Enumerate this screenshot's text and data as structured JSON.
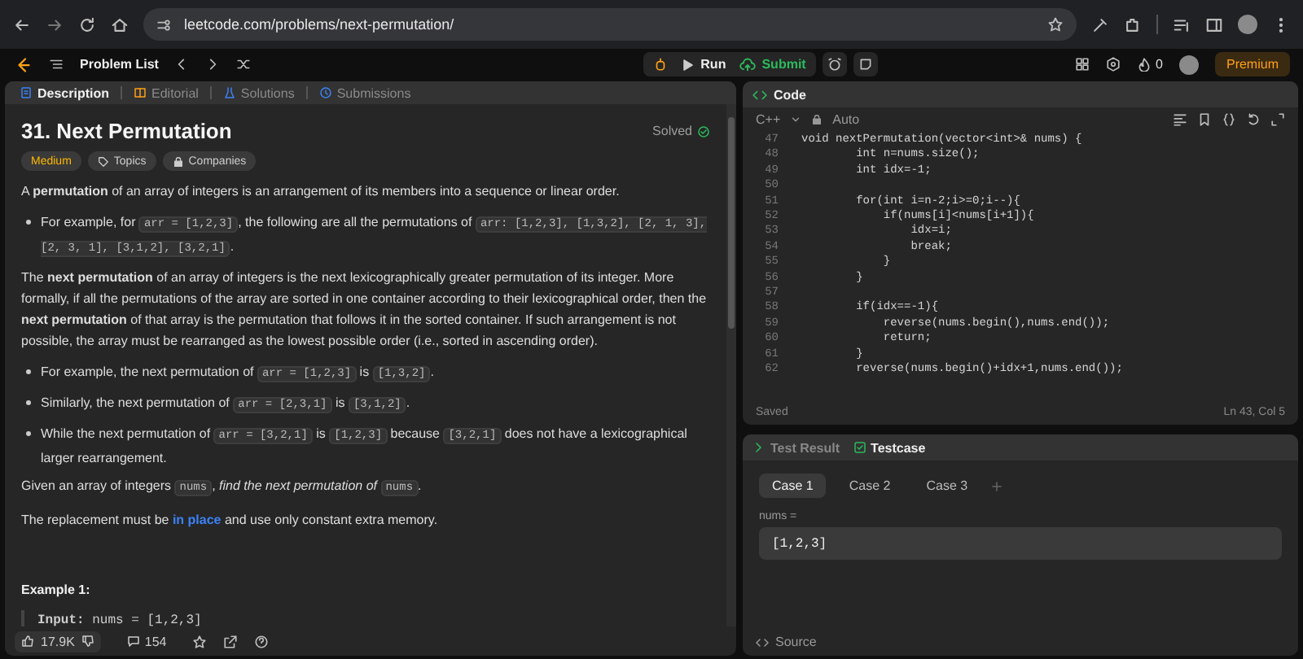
{
  "browser": {
    "url": "leetcode.com/problems/next-permutation/"
  },
  "nav": {
    "problem_list": "Problem List",
    "run": "Run",
    "submit": "Submit",
    "coins": "0",
    "premium": "Premium"
  },
  "left_tabs": [
    {
      "label": "Description",
      "selected": true
    },
    {
      "label": "Editorial",
      "selected": false
    },
    {
      "label": "Solutions",
      "selected": false
    },
    {
      "label": "Submissions",
      "selected": false
    }
  ],
  "problem": {
    "title": "31. Next Permutation",
    "status": "Solved",
    "difficulty": "Medium",
    "tags": [
      "Topics",
      "Companies"
    ]
  },
  "description": [
    {
      "kind": "p",
      "parts": [
        {
          "kind": "text",
          "text": "A **permutation** of an array of integers is an arrangement of its members into a sequence or linear order."
        }
      ]
    },
    {
      "kind": "bullet",
      "parts": [
        {
          "kind": "text",
          "text": "For example, for "
        },
        {
          "kind": "code",
          "text": "arr = [1,2,3]"
        },
        {
          "kind": "text",
          "text": ", the following are all the permutations of "
        },
        {
          "kind": "code",
          "text": "arr: [1,2,3], [1,3,2], [2, 1, 3], [2, 3, 1], [3,1,2], [3,2,1]"
        },
        {
          "kind": "text",
          "text": "."
        }
      ]
    },
    {
      "kind": "p",
      "parts": [
        {
          "kind": "text",
          "text": "The **next permutation** of an array of integers is the next lexicographically greater permutation of its integer. More formally, if all the permutations of the array are sorted in one container according to their lexicographical order, then the **next permutation** of that array is the permutation that follows it in the sorted container. If such arrangement is not possible, the array must be rearranged as the lowest possible order (i.e., sorted in ascending order)."
        }
      ]
    },
    {
      "kind": "bullet",
      "parts": [
        {
          "kind": "text",
          "text": "For example, the next permutation of "
        },
        {
          "kind": "code",
          "text": "arr = [1,2,3]"
        },
        {
          "kind": "text",
          "text": " is "
        },
        {
          "kind": "code",
          "text": "[1,3,2]"
        },
        {
          "kind": "text",
          "text": "."
        }
      ]
    },
    {
      "kind": "bullet",
      "parts": [
        {
          "kind": "text",
          "text": "Similarly, the next permutation of "
        },
        {
          "kind": "code",
          "text": "arr = [2,3,1]"
        },
        {
          "kind": "text",
          "text": " is "
        },
        {
          "kind": "code",
          "text": "[3,1,2]"
        },
        {
          "kind": "text",
          "text": "."
        }
      ]
    },
    {
      "kind": "bullet",
      "parts": [
        {
          "kind": "text",
          "text": "While the next permutation of "
        },
        {
          "kind": "code",
          "text": "arr = [3,2,1]"
        },
        {
          "kind": "text",
          "text": " is "
        },
        {
          "kind": "code",
          "text": "[1,2,3]"
        },
        {
          "kind": "text",
          "text": " because "
        },
        {
          "kind": "code",
          "text": "[3,2,1]"
        },
        {
          "kind": "text",
          "text": " does not have a lexicographical larger rearrangement."
        }
      ]
    },
    {
      "kind": "p",
      "parts": [
        {
          "kind": "text",
          "text": "Given an array of integers "
        },
        {
          "kind": "code",
          "text": "nums"
        },
        {
          "kind": "text",
          "text": ", *find the next permutation of* "
        },
        {
          "kind": "code",
          "text": "nums"
        },
        {
          "kind": "text",
          "text": "."
        }
      ]
    },
    {
      "kind": "p",
      "parts": [
        {
          "kind": "text",
          "text": "The replacement must be "
        },
        {
          "kind": "link",
          "text": "in place"
        },
        {
          "kind": "text",
          "text": " and use only constant extra memory."
        }
      ]
    },
    {
      "kind": "heading",
      "parts": [
        {
          "kind": "text",
          "text": "Example 1:"
        }
      ]
    },
    {
      "kind": "example",
      "parts": [
        {
          "kind": "text",
          "text": "**Input:** nums = [1,2,3]"
        }
      ]
    }
  ],
  "footer": {
    "likes": "17.9K",
    "comments": "154"
  },
  "code": {
    "title": "Code",
    "language": "C++",
    "mode": "Auto",
    "status": "Saved",
    "cursor": "Ln 43, Col 5",
    "lines": [
      {
        "n": "47",
        "code": "void nextPermutation(vector<int>& nums) {"
      },
      {
        "n": "48",
        "code": "        int n=nums.size();"
      },
      {
        "n": "49",
        "code": "        int idx=-1;"
      },
      {
        "n": "50"
      },
      {
        "n": "51",
        "code": "        for(int i=n-2;i>=0;i--){"
      },
      {
        "n": "52",
        "code": "            if(nums[i]<nums[i+1]){"
      },
      {
        "n": "53",
        "code": "                idx=i;"
      },
      {
        "n": "54",
        "code": "                break;"
      },
      {
        "n": "55",
        "code": "            }"
      },
      {
        "n": "56",
        "code": "        }"
      },
      {
        "n": "57"
      },
      {
        "n": "58",
        "code": "        if(idx==-1){"
      },
      {
        "n": "59",
        "code": "            reverse(nums.begin(),nums.end());"
      },
      {
        "n": "60",
        "code": "            return;"
      },
      {
        "n": "61",
        "code": "        }"
      },
      {
        "n": "62",
        "code": "        reverse(nums.begin()+idx+1,nums.end());"
      }
    ]
  },
  "test": {
    "tabs": [
      {
        "label": "Test Result",
        "selected": false
      },
      {
        "label": "Testcase",
        "selected": true
      }
    ],
    "cases": [
      {
        "label": "Case 1",
        "selected": true
      },
      {
        "label": "Case 2",
        "selected": false
      },
      {
        "label": "Case 3",
        "selected": false
      }
    ],
    "param_label": "nums =",
    "param_value": "[1,2,3]",
    "source": "Source"
  }
}
